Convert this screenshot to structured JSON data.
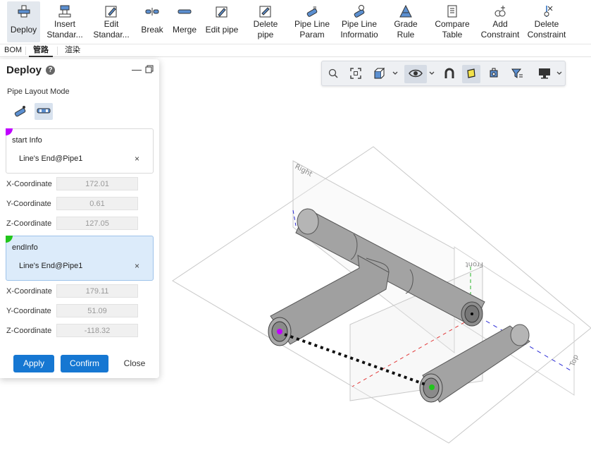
{
  "ribbon": {
    "buttons": [
      {
        "id": "deploy",
        "label1": "Deploy",
        "label2": "",
        "icon": "pipe-deploy-icon",
        "active": true
      },
      {
        "id": "insert-standard",
        "label1": "Insert",
        "label2": "Standar...",
        "icon": "insert-standard-icon"
      },
      {
        "id": "edit-standard",
        "label1": "Edit",
        "label2": "Standar...",
        "icon": "edit-standard-icon"
      },
      {
        "id": "break",
        "label1": "Break",
        "label2": "",
        "icon": "break-icon"
      },
      {
        "id": "merge",
        "label1": "Merge",
        "label2": "",
        "icon": "merge-icon"
      },
      {
        "id": "edit-pipe",
        "label1": "Edit pipe",
        "label2": "",
        "icon": "edit-pipe-icon"
      },
      {
        "id": "delete-pipe",
        "label1": "Delete",
        "label2": "pipe",
        "icon": "delete-pipe-icon"
      },
      {
        "id": "pipe-line-param",
        "label1": "Pipe Line",
        "label2": "Param",
        "icon": "pipe-line-param-icon"
      },
      {
        "id": "pipe-line-info",
        "label1": "Pipe Line",
        "label2": "Informatio",
        "icon": "pipe-line-info-icon"
      },
      {
        "id": "grade-rule",
        "label1": "Grade",
        "label2": "Rule",
        "icon": "grade-rule-icon"
      },
      {
        "id": "compare-table",
        "label1": "Compare",
        "label2": "Table",
        "icon": "compare-table-icon"
      },
      {
        "id": "add-constraint",
        "label1": "Add",
        "label2": "Constraint",
        "icon": "add-constraint-icon"
      },
      {
        "id": "delete-constraint",
        "label1": "Delete",
        "label2": "Constraint",
        "icon": "delete-constraint-icon"
      }
    ]
  },
  "tabs": [
    {
      "label": "BOM",
      "active": false
    },
    {
      "label": "管路",
      "active": true
    },
    {
      "label": "渲染",
      "active": false
    }
  ],
  "view_toolbar": {
    "icons": [
      "zoom-icon",
      "fit-view-icon",
      "cube-view-icon",
      "chevron-down-icon",
      "visibility-icon",
      "chevron-down-icon",
      "magnet-icon",
      "face-select-icon",
      "part-select-icon",
      "filter-icon",
      "display-monitor-icon",
      "chevron-down-icon"
    ]
  },
  "panel": {
    "title": "Deploy",
    "help": "?",
    "minimize": "—",
    "mode_label": "Pipe Layout Mode",
    "start": {
      "title": "start Info",
      "value": "Line's End@Pipe1",
      "close": "×",
      "dot_color": "#c000ff"
    },
    "start_coords": [
      {
        "label": "X-Coordinate",
        "value": "172.01"
      },
      {
        "label": "Y-Coordinate",
        "value": "0.61"
      },
      {
        "label": "Z-Coordinate",
        "value": "127.05"
      }
    ],
    "end": {
      "title": "endInfo",
      "value": "Line's End@Pipe1",
      "close": "×",
      "dot_color": "#22c51c"
    },
    "end_coords": [
      {
        "label": "X-Coordinate",
        "value": "179.11"
      },
      {
        "label": "Y-Coordinate",
        "value": "51.09"
      },
      {
        "label": "Z-Coordinate",
        "value": "-118.32"
      }
    ],
    "apply_label": "Apply",
    "confirm_label": "Confirm",
    "close_label": "Close"
  },
  "scene": {
    "plane_labels": {
      "right": "Right",
      "front": "Front",
      "top": "Top"
    },
    "colors": {
      "pipe": "#9b9b9b",
      "pipe_dark": "#7d7d7d",
      "start_point": "#c000ff",
      "end_point": "#22c51c",
      "accent": "#1677d2"
    }
  }
}
